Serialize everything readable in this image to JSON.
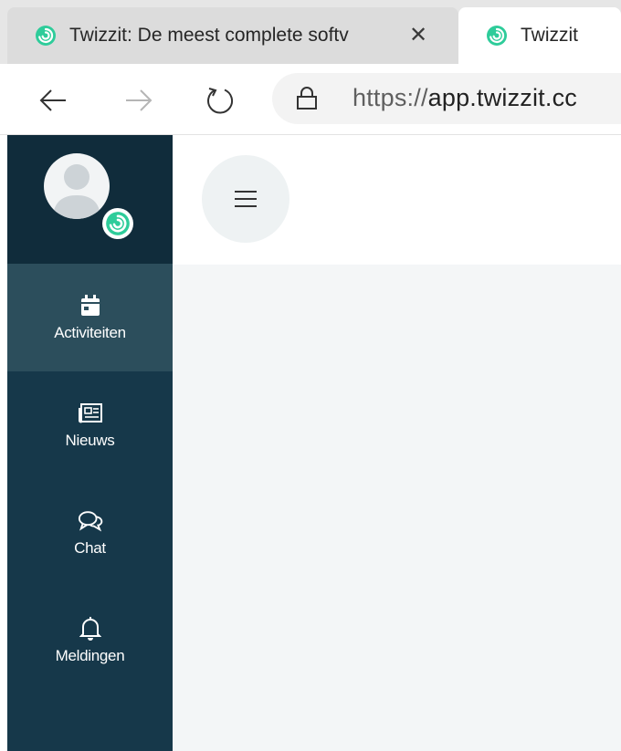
{
  "browser": {
    "tabs": [
      {
        "title": "Twizzit: De meest complete softv",
        "active": false,
        "close_label": "✕"
      },
      {
        "title": "Twizzit",
        "active": true
      }
    ],
    "address": {
      "scheme": "https://",
      "host": "app.twizzit.cc"
    }
  },
  "app": {
    "brand_color": "#2ecc9a",
    "sidebar_color": "#16384a",
    "nav": [
      {
        "label": "Activiteiten",
        "icon": "calendar-icon",
        "active": true
      },
      {
        "label": "Nieuws",
        "icon": "newspaper-icon",
        "active": false
      },
      {
        "label": "Chat",
        "icon": "chat-icon",
        "active": false
      },
      {
        "label": "Meldingen",
        "icon": "bell-icon",
        "active": false
      }
    ]
  }
}
